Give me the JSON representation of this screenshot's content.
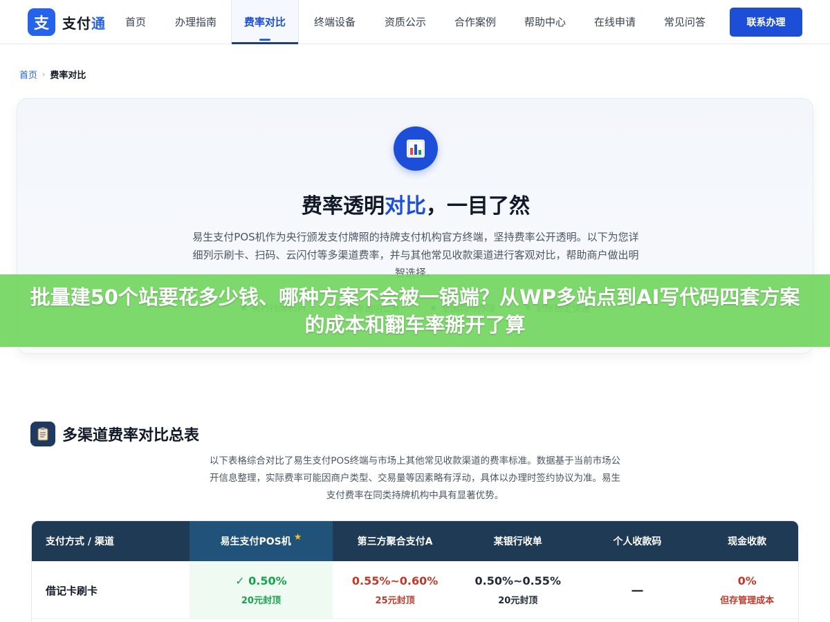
{
  "header": {
    "logo_mark": "支",
    "logo_text_a": "支付",
    "logo_text_b": "通",
    "nav": [
      {
        "label": "首页",
        "width": 72
      },
      {
        "label": "办理指南",
        "width": 102
      },
      {
        "label": "费率对比",
        "width": 98,
        "active": true
      },
      {
        "label": "终端设备",
        "width": 104
      },
      {
        "label": "资质公示",
        "width": 100
      },
      {
        "label": "合作案例",
        "width": 102
      },
      {
        "label": "帮助中心",
        "width": 100
      },
      {
        "label": "在线申请",
        "width": 102
      },
      {
        "label": "常见问答",
        "width": 100
      }
    ],
    "cta_label": "联系办理"
  },
  "breadcrumb": {
    "home": "首页",
    "separator": "›",
    "current": "费率对比"
  },
  "hero": {
    "icon": "bar-chart-icon",
    "title_a": "费率透明",
    "title_b": "对比",
    "title_c": "，一目了然",
    "description": "易生支付POS机作为央行颁发支付牌照的持牌支付机构官方终端，坚持费率公开透明。以下为您详细列示刷卡、扫码、云闪付等多渠道费率，并与其他常见收款渠道进行客观对比，帮助商户做出明智选择。",
    "tags": [
      "央行持牌机构",
      "费率透明公开",
      "全国均可办理",
      "到账稳定快速"
    ]
  },
  "banner": {
    "text": "批量建50个站要花多少钱、哪种方案不会被一锅端？从WP多站点到AI写代码四套方案的成本和翻车率掰开了算"
  },
  "section": {
    "icon": "clipboard-icon",
    "title": "多渠道费率对比总表",
    "description": "以下表格综合对比了易生支付POS终端与市场上其他常见收款渠道的费率标准。数据基于当前市场公开信息整理，实际费率可能因商户类型、交易量等因素略有浮动，具体以办理时签约协议为准。易生支付费率在同类持牌机构中具有显著优势。"
  },
  "table": {
    "columns": [
      {
        "label": "支付方式 / 渠道",
        "width": 228
      },
      {
        "label": "易生支付POS机",
        "width": 208,
        "featured": true,
        "star": "★"
      },
      {
        "label": "第三方聚合支付A",
        "width": 180
      },
      {
        "label": "某银行收单",
        "width": 176
      },
      {
        "label": "个人收款码",
        "width": 170
      },
      {
        "label": "现金收款",
        "width": 148
      }
    ],
    "rows": [
      {
        "label": "借记卡刷卡",
        "cells": [
          {
            "main": "✓ 0.50%",
            "sub": "20元封顶",
            "color": "green"
          },
          {
            "main": "0.55%~0.60%",
            "sub": "25元封顶",
            "color": "red"
          },
          {
            "main": "0.50%~0.55%",
            "sub": "20元封顶",
            "color": "dark"
          },
          {
            "main": "—",
            "sub": "",
            "color": "dash"
          },
          {
            "main": "0%",
            "sub": "但存管理成本",
            "color": "red"
          }
        ]
      }
    ]
  }
}
